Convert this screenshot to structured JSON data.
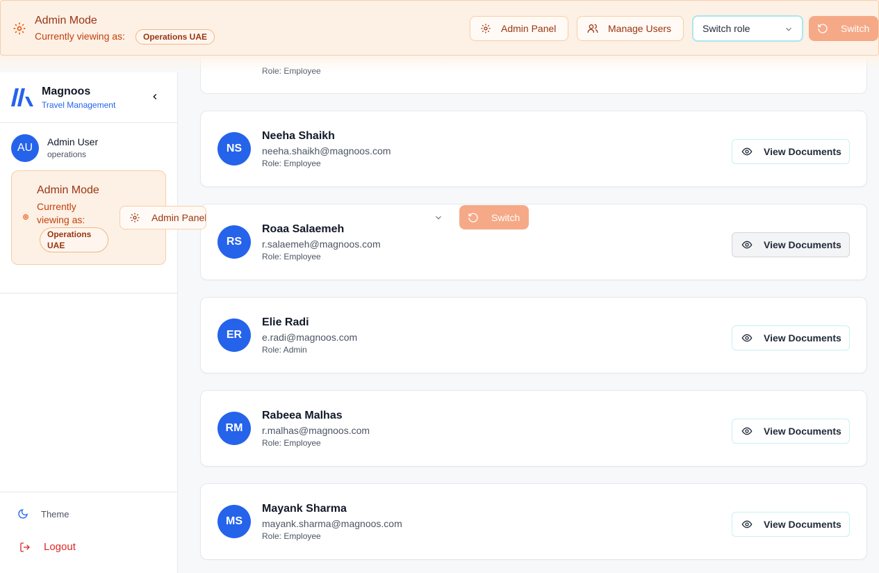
{
  "banner": {
    "title": "Admin Mode",
    "viewing_label": "Currently viewing as:",
    "viewing_value": "Operations UAE",
    "admin_panel_label": "Admin Panel",
    "manage_users_label": "Manage Users",
    "switch_role_value": "Switch role",
    "switch_label": "Switch"
  },
  "sidebar": {
    "brand": "Magnoos",
    "tagline": "Travel Management",
    "user": {
      "initials": "AU",
      "name": "Admin User",
      "role": "operations"
    },
    "admin_card": {
      "title": "Admin Mode",
      "viewing_label": "Currently viewing as:",
      "viewing_value": "Operations UAE",
      "admin_panel_label": "Admin Panel"
    },
    "theme_label": "Theme",
    "logout_label": "Logout"
  },
  "overlay": {
    "switch_label": "Switch"
  },
  "partial_card": {
    "role": "Role: Employee"
  },
  "users": [
    {
      "initials": "NS",
      "name": "Neeha Shaikh",
      "email": "neeha.shaikh@magnoos.com",
      "role": "Role: Employee",
      "action": "View Documents"
    },
    {
      "initials": "RS",
      "name": "Roaa Salaemeh",
      "email": "r.salaemeh@magnoos.com",
      "role": "Role: Employee",
      "action": "View Documents"
    },
    {
      "initials": "ER",
      "name": "Elie Radi",
      "email": "e.radi@magnoos.com",
      "role": "Role: Admin",
      "action": "View Documents"
    },
    {
      "initials": "RM",
      "name": "Rabeea Malhas",
      "email": "r.malhas@magnoos.com",
      "role": "Role: Employee",
      "action": "View Documents"
    },
    {
      "initials": "MS",
      "name": "Mayank Sharma",
      "email": "mayank.sharma@magnoos.com",
      "role": "Role: Employee",
      "action": "View Documents"
    }
  ],
  "colors": {
    "accent": "#2563eb",
    "admin_bg": "#fdf0e5",
    "admin_text": "#9a3412",
    "switch_bg": "#f5a987",
    "logout": "#dc2626"
  },
  "icons": [
    "gear-icon",
    "users-icon",
    "chevron-down-icon",
    "refresh-icon",
    "chevron-left-icon",
    "moon-icon",
    "logout-icon",
    "eye-icon"
  ]
}
